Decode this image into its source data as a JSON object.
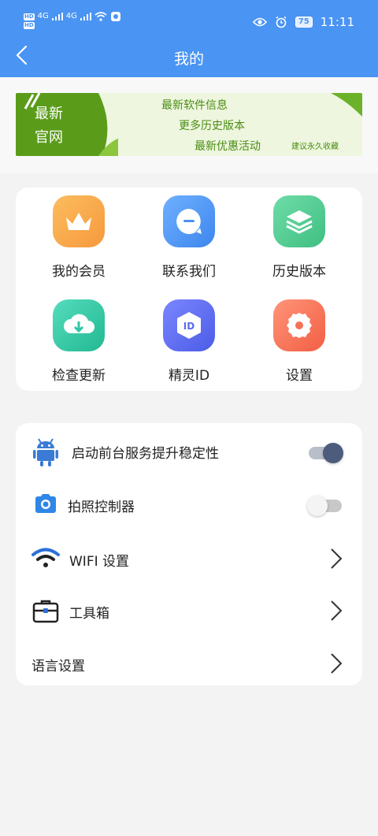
{
  "status_bar": {
    "signal_text": "4G",
    "hd_label": "HD",
    "battery": "75",
    "time": "11:11"
  },
  "header": {
    "title": "我的",
    "background": "#4a94f3"
  },
  "banner": {
    "title_line1": "最新",
    "title_line2": "官网",
    "lines": [
      "最新软件信息",
      "更多历史版本",
      "最新优惠活动"
    ],
    "note": "建议永久收藏"
  },
  "grid": {
    "items": [
      {
        "label": "我的会员",
        "icon": "crown-icon",
        "color": "#f7a24a"
      },
      {
        "label": "联系我们",
        "icon": "chat-bubble-icon",
        "color": "#4a90f0"
      },
      {
        "label": "历史版本",
        "icon": "layers-icon",
        "color": "#4cc98c"
      },
      {
        "label": "检查更新",
        "icon": "cloud-download-icon",
        "color": "#2fc6a2"
      },
      {
        "label": "精灵ID",
        "icon": "id-badge-icon",
        "color": "#5a6cf0"
      },
      {
        "label": "设置",
        "icon": "gear-icon",
        "color": "#f57256"
      }
    ]
  },
  "settings": {
    "foreground_service": {
      "label": "启动前台服务提升稳定性",
      "enabled": true
    },
    "camera_controller": {
      "label": "拍照控制器",
      "enabled": false
    },
    "wifi": {
      "label": "WIFI 设置"
    },
    "toolbox": {
      "label": "工具箱"
    },
    "language": {
      "label": "语言设置"
    }
  }
}
